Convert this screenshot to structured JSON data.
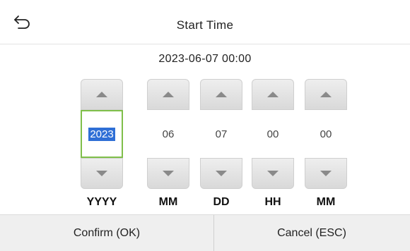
{
  "header": {
    "back_icon": "back-arrow-icon",
    "title": "Start Time"
  },
  "current_value": "2023-06-07 00:00",
  "fields": [
    {
      "key": "year",
      "value": "2023",
      "label": "YYYY",
      "selected": true
    },
    {
      "key": "month",
      "value": "06",
      "label": "MM",
      "selected": false
    },
    {
      "key": "day",
      "value": "07",
      "label": "DD",
      "selected": false
    },
    {
      "key": "hour",
      "value": "00",
      "label": "HH",
      "selected": false
    },
    {
      "key": "minute",
      "value": "00",
      "label": "MM",
      "selected": false
    }
  ],
  "footer": {
    "confirm_label": "Confirm (OK)",
    "cancel_label": "Cancel (ESC)"
  },
  "colors": {
    "selected_border": "#7fbf4a",
    "selected_highlight": "#2f6fd6",
    "footer_bg": "#efefef"
  }
}
